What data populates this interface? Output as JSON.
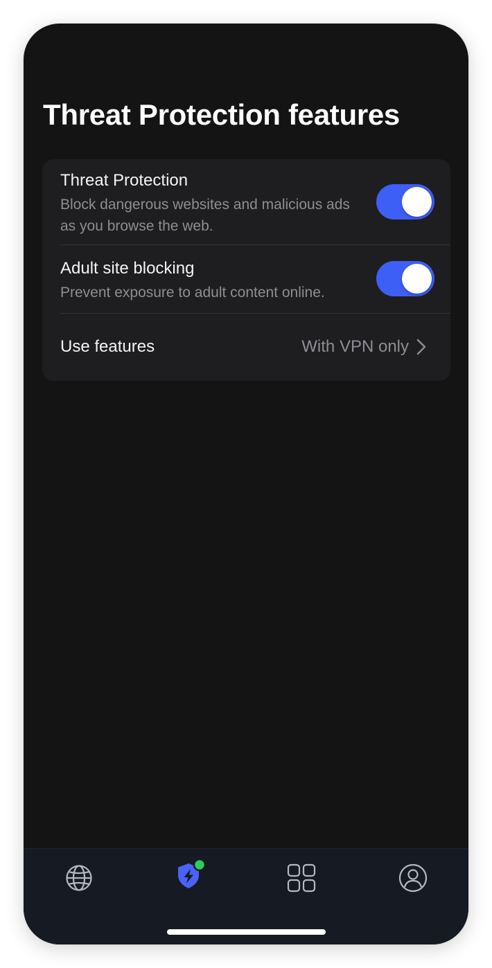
{
  "page": {
    "title": "Threat Protection features"
  },
  "settings": {
    "threat_protection": {
      "title": "Threat Protection",
      "description": "Block dangerous websites and malicious ads as you browse the web.",
      "enabled": true
    },
    "adult_site_blocking": {
      "title": "Adult site blocking",
      "description": "Prevent exposure to adult content online.",
      "enabled": true
    },
    "use_features": {
      "title": "Use features",
      "value": "With VPN only"
    }
  },
  "tabbar": {
    "tabs": [
      {
        "icon": "globe-icon",
        "active": false
      },
      {
        "icon": "shield-bolt-icon",
        "active": true,
        "badge": "green-dot"
      },
      {
        "icon": "grid-icon",
        "active": false
      },
      {
        "icon": "profile-icon",
        "active": false
      }
    ]
  },
  "colors": {
    "background": "#141414",
    "card": "#1e1e20",
    "accent": "#3e5ff5",
    "badge": "#2ecc5a",
    "tabbar": "#161a23"
  }
}
